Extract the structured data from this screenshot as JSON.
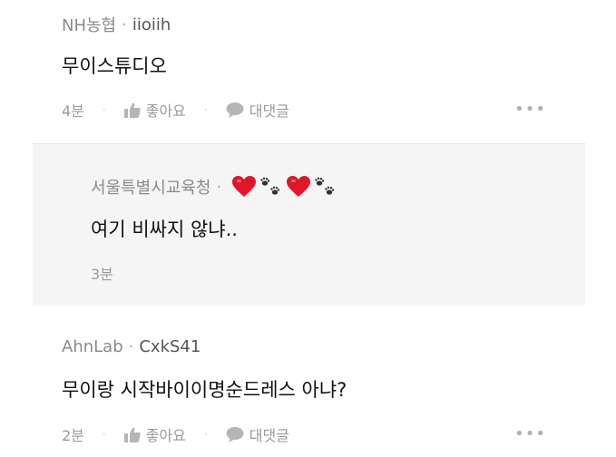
{
  "comments": [
    {
      "org": "NH농협",
      "nick": "iioiih",
      "text": "무이스튜디오",
      "time": "4분",
      "like_label": "좋아요",
      "reply_label": "대댓글"
    },
    {
      "org": "AhnLab",
      "nick": "CxkS41",
      "text": "무이랑 시작바이이명순드레스 아냐?",
      "time": "2분",
      "like_label": "좋아요",
      "reply_label": "대댓글"
    }
  ],
  "reply": {
    "org": "서울특별시교육청",
    "emoji": [
      "red-heart",
      "paw-prints",
      "red-heart",
      "paw-prints"
    ],
    "text": "여기 비싸지 않냐..",
    "time": "3분"
  },
  "colors": {
    "heart": "#e0162b",
    "reply_bg": "#f5f5f5",
    "muted": "#9a9a9a"
  },
  "more_glyph": "•••",
  "dot_sep": "·"
}
